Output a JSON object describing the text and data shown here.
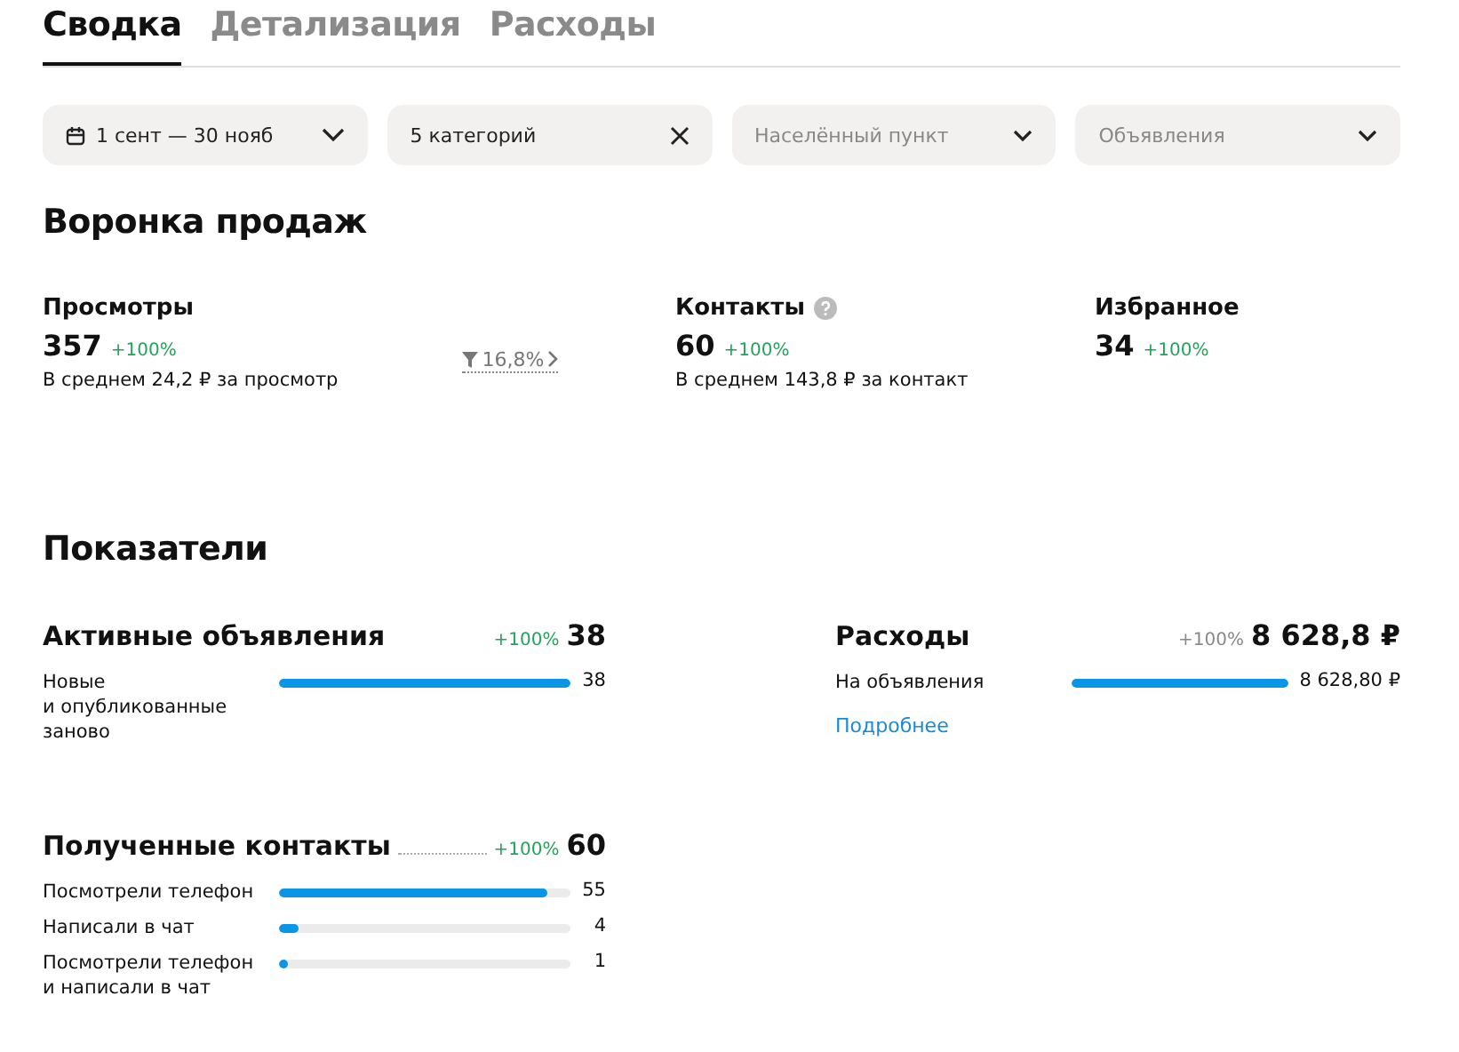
{
  "tabs": [
    {
      "label": "Сводка",
      "selected": true
    },
    {
      "label": "Детализация",
      "selected": false
    },
    {
      "label": "Расходы",
      "selected": false
    }
  ],
  "filters": [
    {
      "kind": "date",
      "value": "1 сент — 30 нояб"
    },
    {
      "kind": "clearable",
      "value": "5 категорий"
    },
    {
      "kind": "select",
      "placeholder": "Населённый пункт"
    },
    {
      "kind": "select",
      "placeholder": "Объявления"
    }
  ],
  "funnel": {
    "title": "Воронка продаж",
    "steps": [
      {
        "label": "Просмотры",
        "value": "357",
        "change": "+100%",
        "note": "В среднем 24,2 ₽ за просмотр",
        "conversion": "16,8%",
        "help": false
      },
      {
        "label": "Контакты",
        "value": "60",
        "change": "+100%",
        "note": "В среднем 143,8 ₽ за контакт",
        "help": true
      },
      {
        "label": "Избранное",
        "value": "34",
        "change": "+100%",
        "help": false
      }
    ]
  },
  "indicators": {
    "title": "Показатели",
    "panels": [
      {
        "title": "Активные объявления",
        "change": "+100%",
        "positive": true,
        "total": "38",
        "dotted": false,
        "rows": [
          {
            "label": "Новые\nи опубликованные\nзаново",
            "level": 1,
            "value": "38"
          }
        ]
      },
      {
        "title": "Расходы",
        "change": "+100%",
        "positive": false,
        "total": "8 628,8 ₽",
        "dotted": false,
        "rows": [
          {
            "label": "На объявления",
            "level": 1,
            "value": "8 628,80 ₽"
          }
        ],
        "link": "Подробнее"
      },
      {
        "title": "Полученные контакты",
        "change": "+100%",
        "positive": true,
        "total": "60",
        "dotted": true,
        "rows": [
          {
            "label": "Посмотрели телефон",
            "level": 0.92,
            "value": "55"
          },
          {
            "label": "Написали в чат",
            "level": 0.07,
            "value": "4"
          },
          {
            "label": "Посмотрели телефон\nи написали в чат",
            "level": 0.03,
            "value": "1"
          }
        ]
      }
    ]
  }
}
